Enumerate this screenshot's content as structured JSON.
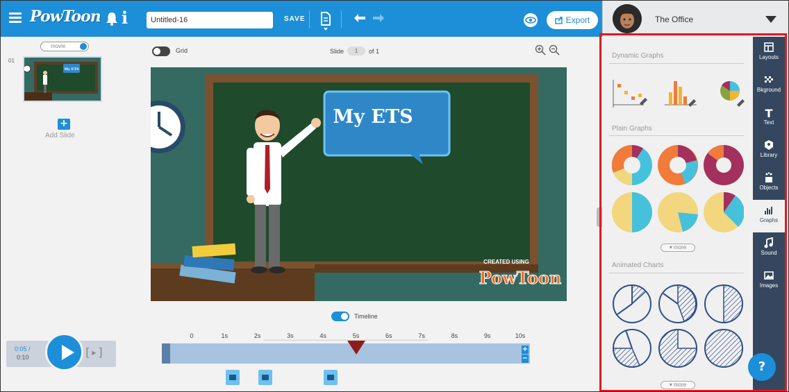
{
  "app": {
    "logo_text": "PowToon",
    "document_title": "Untitled-16",
    "save_label": "SAVE",
    "export_label": "Export"
  },
  "user": {
    "name": "The Office"
  },
  "slides_panel": {
    "movie_label": "movie",
    "slide_number": "01",
    "add_slide_label": "Add Slide",
    "thumb_text": "My ETS"
  },
  "stage": {
    "grid_label": "Grid",
    "slide_label": "Slide",
    "current_slide": "1",
    "of_label": "of 1",
    "bubble_text": "My ETS",
    "watermark_top": "CREATED USING",
    "watermark_logo": "PowToon"
  },
  "timeline": {
    "toggle_label": "Timeline",
    "current_time": "0:05 /",
    "total_time": "0:10",
    "ticks": [
      "0",
      "1s",
      "2s",
      "3s",
      "4s",
      "5s",
      "6s",
      "7s",
      "8s",
      "9s",
      "10s"
    ],
    "playhead_seconds": 5
  },
  "graphs_panel": {
    "dynamic_title": "Dynamic Graphs",
    "plain_title": "Plain Graphs",
    "animated_title": "Animated Charts",
    "more_label": "more"
  },
  "nav": {
    "items": [
      {
        "label": "Layouts",
        "icon": "layouts-icon"
      },
      {
        "label": "Bkground",
        "icon": "background-icon"
      },
      {
        "label": "Text",
        "icon": "text-icon"
      },
      {
        "label": "Library",
        "icon": "library-icon"
      },
      {
        "label": "Objects",
        "icon": "objects-icon"
      },
      {
        "label": "Graphs",
        "icon": "graphs-icon"
      },
      {
        "label": "Sound",
        "icon": "sound-icon"
      },
      {
        "label": "Images",
        "icon": "images-icon"
      }
    ]
  },
  "help": {
    "label": "?"
  },
  "colors": {
    "brand_blue": "#1d8fd8",
    "nav_dark": "#34475f",
    "highlight_red": "#e3181e",
    "chalkboard": "#1f4a2c",
    "pie_cyan": "#46c1dc",
    "pie_yellow": "#f3d77e",
    "pie_orange": "#f07b3a",
    "pie_maroon": "#a3305d"
  }
}
